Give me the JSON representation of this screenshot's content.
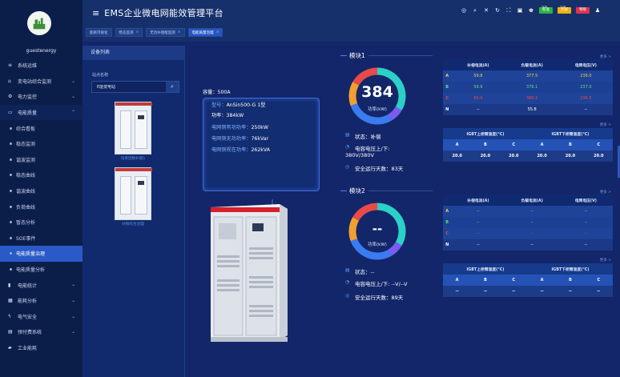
{
  "header": {
    "title": "EMS企业微电网能效管理平台",
    "breadcrumbs": [
      {
        "label": "能耗可视化"
      },
      {
        "label": "稳态监测"
      },
      {
        "label": "无功补偿能监测"
      },
      {
        "label": "电能质量治理"
      }
    ],
    "badges": [
      {
        "label": "标准",
        "color": "#2fb344",
        "up": "TOP"
      },
      {
        "label": "大屏",
        "color": "#f0b10c",
        "up": "TOP"
      },
      {
        "label": "物联",
        "color": "#e0344b"
      }
    ]
  },
  "sidebar": {
    "username": "guestenergy",
    "items": [
      {
        "label": "系统运维",
        "icon": "menu-icon",
        "type": "item"
      },
      {
        "label": "变电站综合监测",
        "icon": "home-icon",
        "type": "item",
        "chev": "⌄"
      },
      {
        "label": "电力监控",
        "icon": "gear-icon",
        "type": "item",
        "chev": "⌄"
      },
      {
        "label": "电能质量",
        "icon": "monitor-icon",
        "type": "group",
        "chev": "⌃"
      },
      {
        "label": "综合看板",
        "type": "sub"
      },
      {
        "label": "稳态监测",
        "type": "sub"
      },
      {
        "label": "谐波监测",
        "type": "sub"
      },
      {
        "label": "稳态曲线",
        "type": "sub"
      },
      {
        "label": "谐波曲线",
        "type": "sub"
      },
      {
        "label": "负荷曲线",
        "type": "sub"
      },
      {
        "label": "暂态分析",
        "type": "sub"
      },
      {
        "label": "SOE事件",
        "type": "sub"
      },
      {
        "label": "电能质量治理",
        "type": "sub-active"
      },
      {
        "label": "电能质量分析",
        "type": "sub"
      },
      {
        "label": "电能统计",
        "icon": "bar-chart-icon",
        "type": "item",
        "chev": "⌄"
      },
      {
        "label": "能耗分析",
        "icon": "report-icon",
        "type": "item",
        "chev": "⌄"
      },
      {
        "label": "电气安全",
        "icon": "bolt-icon",
        "type": "item",
        "chev": "⌄"
      },
      {
        "label": "预付费系统",
        "icon": "wallet-icon",
        "type": "item",
        "chev": "⌄"
      },
      {
        "label": "工业能耗",
        "icon": "factory-icon",
        "type": "item"
      },
      {
        "label": "医疗IT系统",
        "icon": "hospital-icon",
        "type": "item",
        "chev": "⌄"
      }
    ]
  },
  "device_panel": {
    "title": "设备列表",
    "station_label": "站点名称",
    "station_value": "E能变电站",
    "devices": [
      {
        "label": "功率因数补偿1"
      },
      {
        "label": "补偿综合治理"
      }
    ]
  },
  "info": {
    "capacity": "容量：500A",
    "model_prefix": "型号：",
    "model_value": "AnSin500-G 1型",
    "power": "功率：384kW",
    "rows": [
      {
        "label": "电网侧有功功率：",
        "value": "250kW"
      },
      {
        "label": "电网侧无功功率：",
        "value": "76kVar"
      },
      {
        "label": "电网侧视在功率：",
        "value": "262kVA"
      }
    ]
  },
  "modules": [
    {
      "title": "模块1",
      "more": "更多 >",
      "gauge_value": "384",
      "gauge_label": "功率(kW)",
      "status": "状态：补偿",
      "voltage_label": "电容电压上/下:",
      "voltage_value": "380V/380V",
      "days": "安全运行天数：83天",
      "phase_header": [
        "",
        "补偿电流(A)",
        "负载电流(A)",
        "电网电压(V)"
      ],
      "phases": [
        {
          "name": "A",
          "values": [
            "59.8",
            "377.5",
            "236.0"
          ]
        },
        {
          "name": "B",
          "values": [
            "59.9",
            "376.1",
            "237.0"
          ]
        },
        {
          "name": "C",
          "values": [
            "60.0",
            "380.2",
            "236.5"
          ]
        },
        {
          "name": "N",
          "values": [
            "--",
            "55.8",
            "--"
          ]
        }
      ],
      "igbt_more": "更多 >",
      "igbt_groups": [
        "IGBT上桥臂温度(°C)",
        "IGBT下桥臂温度(°C)"
      ],
      "igbt_cols": [
        "A",
        "B",
        "C",
        "A",
        "B",
        "C"
      ],
      "igbt_values": [
        "20.0",
        "20.0",
        "20.0",
        "20.0",
        "20.0",
        "20.0"
      ]
    },
    {
      "title": "模块2",
      "more": "更多 >",
      "gauge_value": "--",
      "gauge_label": "功率(kW)",
      "status": "状态：--",
      "voltage_label": "电容电压上/下: --V/--V",
      "voltage_value": "",
      "days": "安全运行天数：89天",
      "phase_header": [
        "",
        "补偿电流(A)",
        "负载电流(A)",
        "电网电压(V)"
      ],
      "phases": [
        {
          "name": "A",
          "values": [
            "--",
            "--",
            "--"
          ]
        },
        {
          "name": "B",
          "values": [
            "--",
            "--",
            "--"
          ]
        },
        {
          "name": "C",
          "values": [
            "--",
            "--",
            "--"
          ]
        },
        {
          "name": "N",
          "values": [
            "--",
            "--",
            "--"
          ]
        }
      ],
      "igbt_more": "更多 >",
      "igbt_groups": [
        "IGBT上桥臂温度(°C)",
        "IGBT下桥臂温度(°C)"
      ],
      "igbt_cols": [
        "A",
        "B",
        "C",
        "A",
        "B",
        "C"
      ],
      "igbt_values": [
        "--",
        "--",
        "--",
        "--",
        "--",
        "--"
      ]
    }
  ]
}
